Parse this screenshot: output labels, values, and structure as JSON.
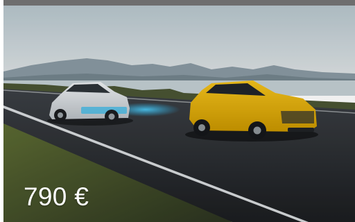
{
  "card": {
    "price": "790 €",
    "image": {
      "subject": "two-cars-on-coastal-road",
      "sky_color": "#c9d4d9",
      "road_color": "#2a2d31",
      "yellow_car_color": "#e6b400",
      "silver_car_color": "#d9dde0",
      "sensor_beam_color": "#2ec0ff"
    }
  }
}
